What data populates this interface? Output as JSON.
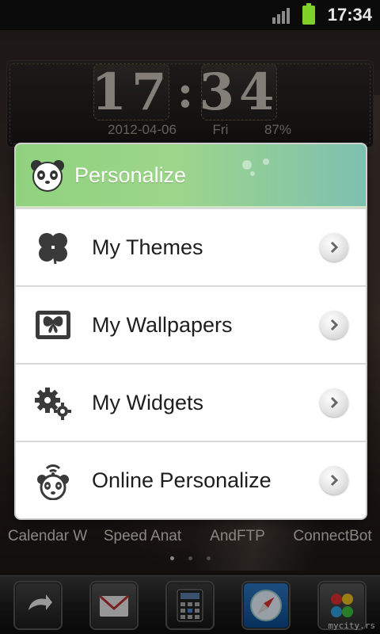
{
  "status_bar": {
    "time": "17:34"
  },
  "clock_widget": {
    "hours": "17",
    "minutes": "34",
    "separator": ":",
    "date": "2012-04-06",
    "weekday": "Fri",
    "battery": "87%"
  },
  "dialog": {
    "title": "Personalize",
    "items": [
      {
        "label": "My Themes",
        "icon": "clover-icon"
      },
      {
        "label": "My Wallpapers",
        "icon": "butterfly-frame-icon"
      },
      {
        "label": "My Widgets",
        "icon": "gears-icon"
      },
      {
        "label": "Online Personalize",
        "icon": "panda-wifi-icon"
      }
    ]
  },
  "home_screen": {
    "app_labels": [
      "Calendar W",
      "Speed Anat",
      "AndFTP",
      "ConnectBot"
    ],
    "dock": [
      "back-arrow-icon",
      "mail-icon",
      "calculator-icon",
      "compass-icon",
      "app-drawer-icon"
    ]
  },
  "watermark": "mycity.rs",
  "colors": {
    "header_green": "#8fd27e",
    "accent_teal": "#7ec0b0",
    "battery_green": "#7fd12a"
  }
}
